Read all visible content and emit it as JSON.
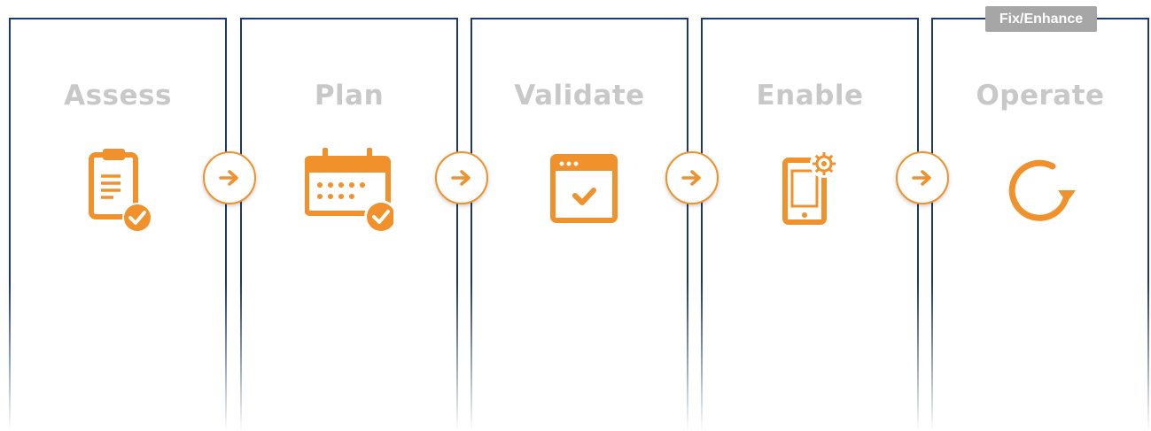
{
  "accent_color": "#f0912b",
  "border_color": "#1b3a6b",
  "title_color": "#c8c8c8",
  "badge": {
    "label": "Fix/Enhance",
    "color": "#a6a6a6"
  },
  "stages": [
    {
      "title": "Assess",
      "icon": "clipboard-check-icon"
    },
    {
      "title": "Plan",
      "icon": "calendar-check-icon"
    },
    {
      "title": "Validate",
      "icon": "browser-window-check-icon"
    },
    {
      "title": "Enable",
      "icon": "mobile-gear-icon"
    },
    {
      "title": "Operate",
      "icon": "refresh-cycle-icon"
    }
  ],
  "connectors": [
    {
      "icon": "arrow-right-icon"
    },
    {
      "icon": "arrow-right-icon"
    },
    {
      "icon": "arrow-right-icon"
    },
    {
      "icon": "arrow-right-icon"
    }
  ]
}
